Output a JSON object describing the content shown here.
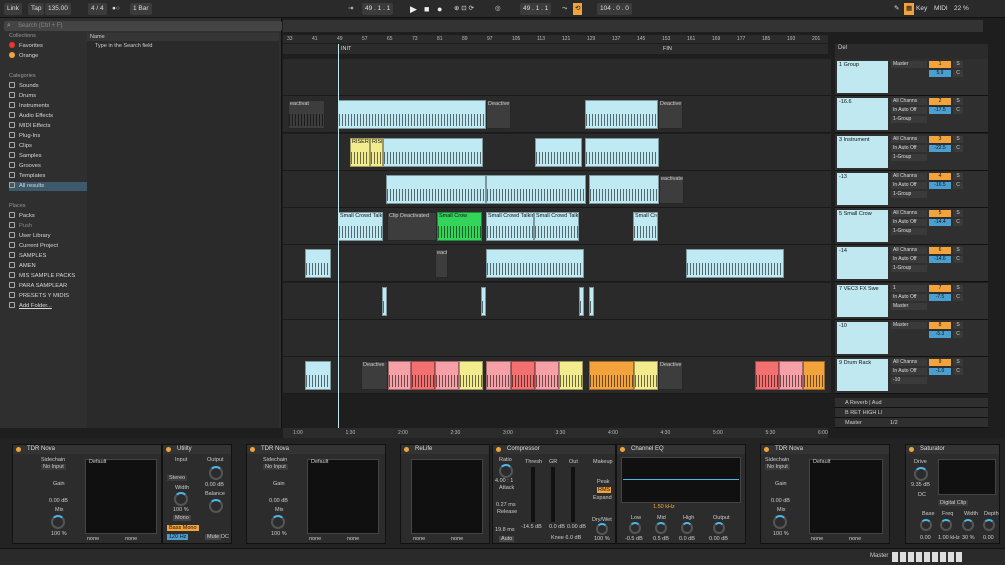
{
  "transport": {
    "link": "Link",
    "tap": "Tap",
    "tempo": "135.00",
    "sig": "4 / 4",
    "quant": "1 Bar",
    "pos": "49 . 1 . 1",
    "loop_start": "49 . 1 . 1",
    "loop_len": "104 . 0 . 0",
    "key": "Key",
    "midi": "MIDI",
    "cpu": "22 %"
  },
  "browser": {
    "search_placeholder": "Search (Ctrl + F)",
    "collections_title": "Collections",
    "col_items": [
      "Favorites",
      "Orange"
    ],
    "categories_title": "Categories",
    "cat_items": [
      "Sounds",
      "Drums",
      "Instruments",
      "Audio Effects",
      "MIDI Effects",
      "Plug-Ins",
      "Clips",
      "Samples",
      "Grooves",
      "Templates",
      "All results"
    ],
    "places_title": "Places",
    "place_items": [
      "Packs",
      "Push",
      "User Library",
      "Current Project",
      "SAMPLES",
      "AMEN",
      "MIS SAMPLE PACKS",
      "PARA SAMPLEAR",
      "PRESETS Y MIDIS",
      "Add Folder..."
    ],
    "col_header": "Name",
    "hint": "Type in the Search field"
  },
  "ruler": {
    "bars": [
      "33",
      "41",
      "49",
      "57",
      "65",
      "73",
      "81",
      "89",
      "97",
      "105",
      "113",
      "121",
      "129",
      "137",
      "145",
      "153",
      "161",
      "169",
      "177",
      "185",
      "193",
      "201"
    ],
    "times": [
      "1:00",
      "1:30",
      "2:00",
      "2:30",
      "3:00",
      "3:30",
      "4:00",
      "4:30",
      "5:00",
      "5:30",
      "6:00"
    ],
    "locators": [
      "INIT",
      "FIN"
    ]
  },
  "clips": {
    "deactivated": "Deactivated",
    "deactive": "Deactive",
    "clip_deactivated": "Clip Deactivated",
    "riser": "RISER",
    "crowd": "Small Crowd Talkin",
    "crowd2": "Small Crow",
    "crowd3": "Small Crowd Talki",
    "deact": "eact",
    "sect": "eactivat",
    "fact": "eactivate"
  },
  "tracks": [
    {
      "name": "1 Group",
      "io1": "Master",
      "num": "1",
      "vol": "5.9",
      "pan": "C"
    },
    {
      "name": "-16.6",
      "io1": "All Channs",
      "io2": "In Auto Off",
      "io3": "1-Group",
      "num": "2",
      "vol": "-17.5",
      "pan": "C"
    },
    {
      "name": "3 Instrument",
      "io1": "All Channs",
      "io2": "In Auto Off",
      "io3": "1-Group",
      "num": "3",
      "vol": "-22.5",
      "pan": "C"
    },
    {
      "name": "-13",
      "io1": "All Channs",
      "io2": "In Auto Off",
      "io3": "1-Group",
      "num": "4",
      "vol": "-16.5",
      "pan": "C"
    },
    {
      "name": "5 Small Crow",
      "io1": "All Channs",
      "io2": "In Auto Off",
      "io3": "1-Group",
      "num": "5",
      "vol": "-14.4",
      "pan": "C"
    },
    {
      "name": "-14",
      "io1": "All Channs",
      "io2": "In Auto Off",
      "io3": "1-Group",
      "num": "6",
      "vol": "-14.6",
      "pan": "C"
    },
    {
      "name": "7 VEC3 FX Swe",
      "io1": "1",
      "io2": "In Auto Off",
      "io3": "Master",
      "num": "7",
      "vol": "-7.5",
      "pan": "C"
    },
    {
      "name": "-10",
      "io1": "Master",
      "num": "8",
      "vol": "-5.3",
      "pan": "C"
    },
    {
      "name": "9 Drum Rack",
      "io1": "All Channs",
      "io2": "In Auto Off",
      "io3": "-10",
      "num": "9",
      "vol": "-1.0",
      "pan": "C"
    }
  ],
  "returns": [
    "A Reverb | Aud",
    "B RET HIGH LI",
    "Master"
  ],
  "master_io": "1/2",
  "devices": {
    "tdr1": "TDR Nova",
    "default": "Default",
    "utility": "Utility",
    "relife": "ReLife",
    "comp": "Compressor",
    "eq": "Channel EQ",
    "tdr2": "TDR Nova",
    "sat": "Saturator",
    "sidechain": "Sidechain",
    "noinput": "No Input",
    "gain": "Gain",
    "mix": "Mix",
    "zero_db": "0.00 dB",
    "pct100": "100 %",
    "input": "Input",
    "output": "Output",
    "width": "Width",
    "mono": "Mono",
    "balance": "Balance",
    "bassmono": "Bass Mono",
    "hz": "120 Hz",
    "mute": "Mute",
    "dc": "DC",
    "stereo": "Stereo",
    "ratio": "Ratio",
    "ratio_v": "4.00 : 1",
    "attack": "Attack",
    "attack_v": "0.27 ms",
    "release": "Release",
    "release_v": "19.8 ms",
    "thresh": "Thresh",
    "gr": "GR",
    "out": "Out",
    "knee": "Knee 6.0 dB",
    "auto": "Auto",
    "makeup": "Makeup",
    "peak": "Peak",
    "rms": "RMS",
    "expand": "Expand",
    "drywet": "Dry/Wet",
    "low": "Low",
    "midk": "Mid",
    "high": "High",
    "eq_low": "-0.5 dB",
    "eq_mid": "0.5 dB",
    "eq_high": "0.0 dB",
    "eq_out": "0.00 dB",
    "freq_v": "1.50 kHz",
    "drive": "9.35 dB",
    "digclip": "Digital Clip",
    "base": "Base",
    "freq": "Freq",
    "width2": "Width",
    "depth": "Depth",
    "base_v": "0.00",
    "freq_v2": "1.00 kHz",
    "width_v": "30 %",
    "depth_v": "0.00",
    "none": "none",
    "thresh_v": "-14.5 dB",
    "gr_v": "0.0 dB",
    "out_v": "0.00 dB",
    "sat_drive": "Drive",
    "clipl": "CLIPP"
  },
  "bottom": {
    "master": "Master"
  },
  "colors": {
    "accent": "#f2a33c",
    "clip_blue": "#bfeaf3",
    "clip_yellow": "#f3ec8f",
    "clip_green": "#33d45a",
    "clip_red": "#f27070"
  }
}
